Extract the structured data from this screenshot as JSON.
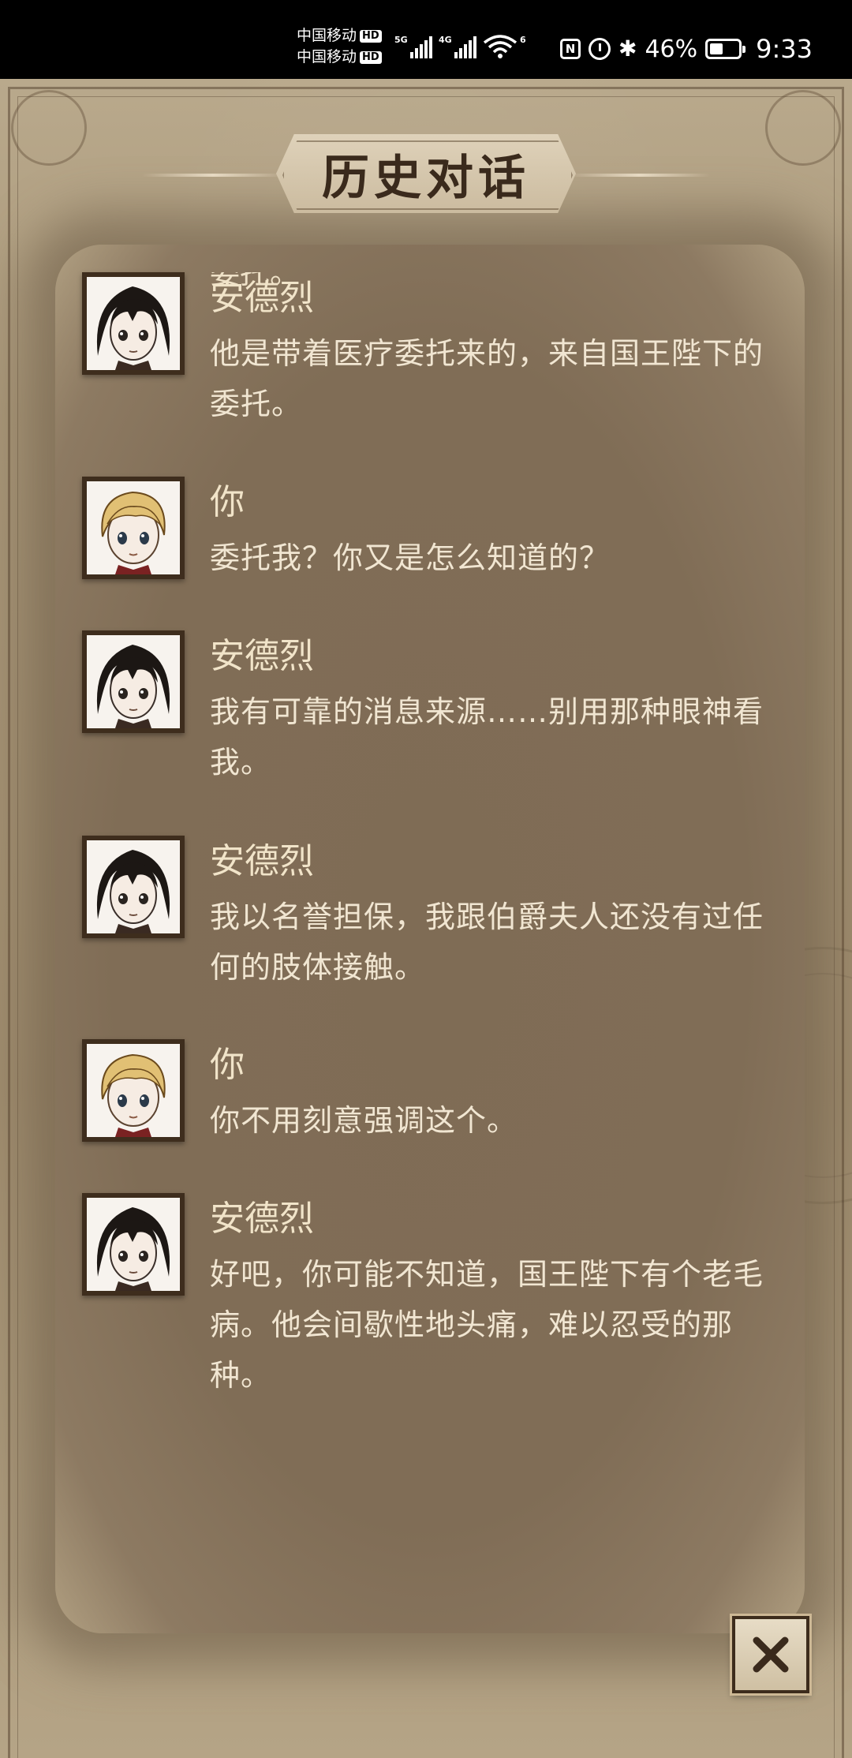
{
  "status_bar": {
    "carrier_1": "中国移动",
    "carrier_2": "中国移动",
    "hd_label": "HD",
    "net_1": "5G",
    "net_2": "4G",
    "wifi_label": "6",
    "nfc_label": "N",
    "battery_percent": "46%",
    "battery_level": 0.46,
    "time": "9:33"
  },
  "screen": {
    "title": "历史对话",
    "cut_line_text": "委托。",
    "close_icon": "close-x-icon"
  },
  "characters": {
    "andrei": {
      "name": "安德烈",
      "hair_color": "#1c1714",
      "avatar_icon": "dark-haired-man-portrait"
    },
    "player": {
      "name": "你",
      "hair_color": "#e1c074",
      "avatar_icon": "blond-man-portrait"
    }
  },
  "dialog": [
    {
      "speaker": "安德烈",
      "character": "andrei",
      "text": "他是带着医疗委托来的，来自国王陛下的委托。"
    },
    {
      "speaker": "你",
      "character": "player",
      "text": "委托我？你又是怎么知道的？"
    },
    {
      "speaker": "安德烈",
      "character": "andrei",
      "text": "我有可靠的消息来源……别用那种眼神看我。"
    },
    {
      "speaker": "安德烈",
      "character": "andrei",
      "text": "我以名誉担保，我跟伯爵夫人还没有过任何的肢体接触。"
    },
    {
      "speaker": "你",
      "character": "player",
      "text": "你不用刻意强调这个。"
    },
    {
      "speaker": "安德烈",
      "character": "andrei",
      "text": "好吧，你可能不知道，国王陛下有个老毛病。他会间歇性地头痛，难以忍受的那种。"
    }
  ],
  "colors": {
    "parchment": "#a99779",
    "dialog_bg": "#806d56",
    "text": "#f1e6d2",
    "frame": "#3e2d1d"
  }
}
